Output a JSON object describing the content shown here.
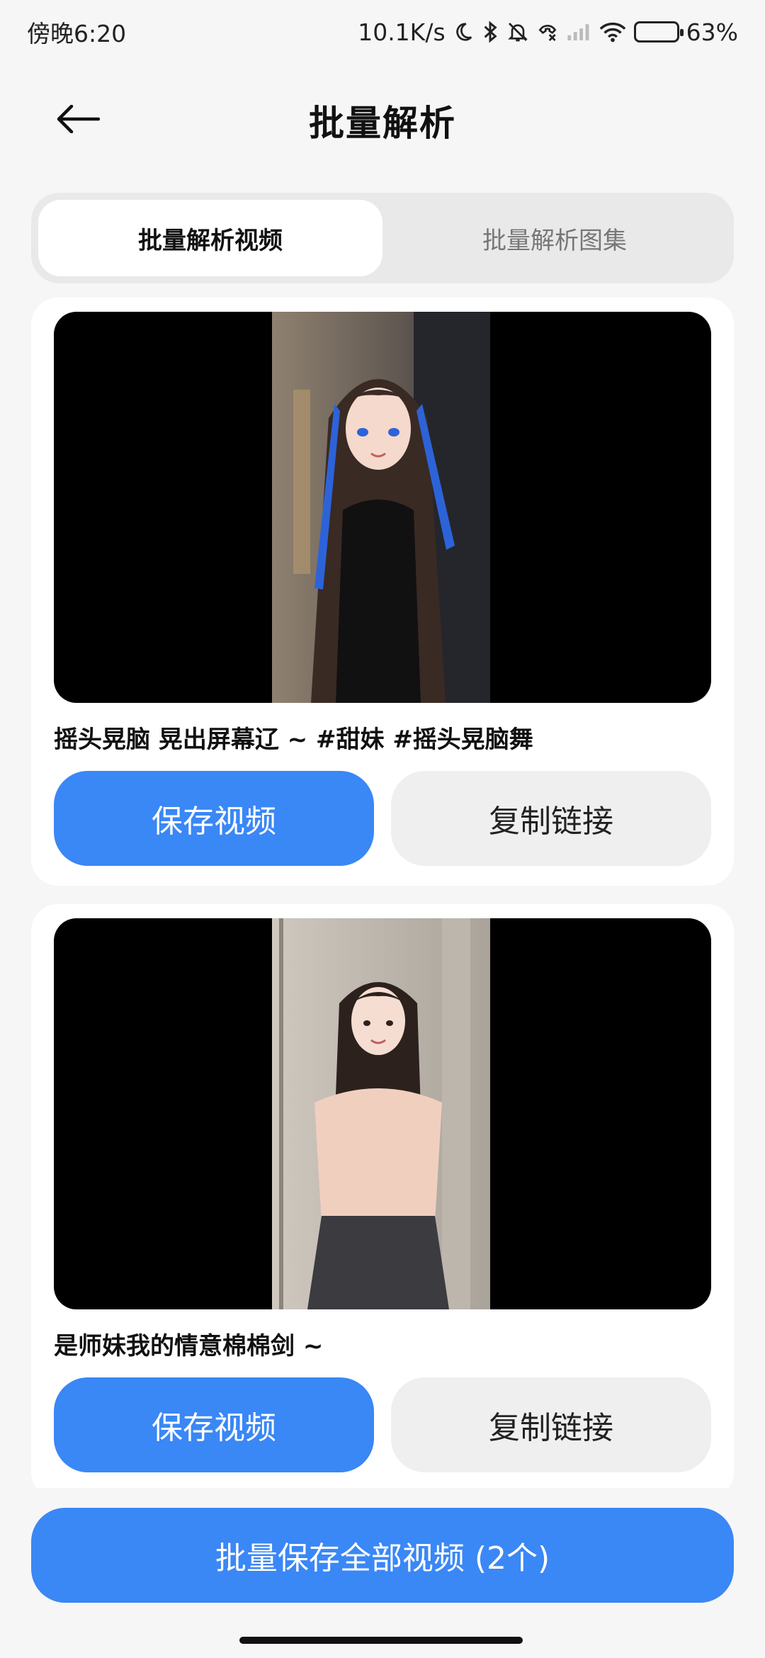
{
  "status_bar": {
    "time": "傍晚6:20",
    "net_speed": "10.1K/s",
    "battery_text": "63%",
    "battery_level": 0.63,
    "icons": [
      "moon-icon",
      "bluetooth-icon",
      "mute-icon",
      "call-missed-icon",
      "signal-icon",
      "wifi-icon",
      "battery-icon"
    ]
  },
  "header": {
    "title": "批量解析",
    "back_icon": "arrow-left-icon"
  },
  "tabs": [
    {
      "label": "批量解析视频",
      "active": true
    },
    {
      "label": "批量解析图集",
      "active": false
    }
  ],
  "videos": [
    {
      "caption": "摇头晃脑 晃出屏幕辽 ~ #甜妹 #摇头晃脑舞",
      "save_label": "保存视频",
      "copy_label": "复制链接"
    },
    {
      "caption": "是师妹我的情意棉棉剑 ~",
      "save_label": "保存视频",
      "copy_label": "复制链接"
    }
  ],
  "bottom_action": {
    "label": "批量保存全部视频 (2个)"
  },
  "colors": {
    "primary": "#3a87f6",
    "page_bg": "#f6f6f6",
    "card_bg": "#ffffff",
    "secondary_btn": "#efefef"
  }
}
